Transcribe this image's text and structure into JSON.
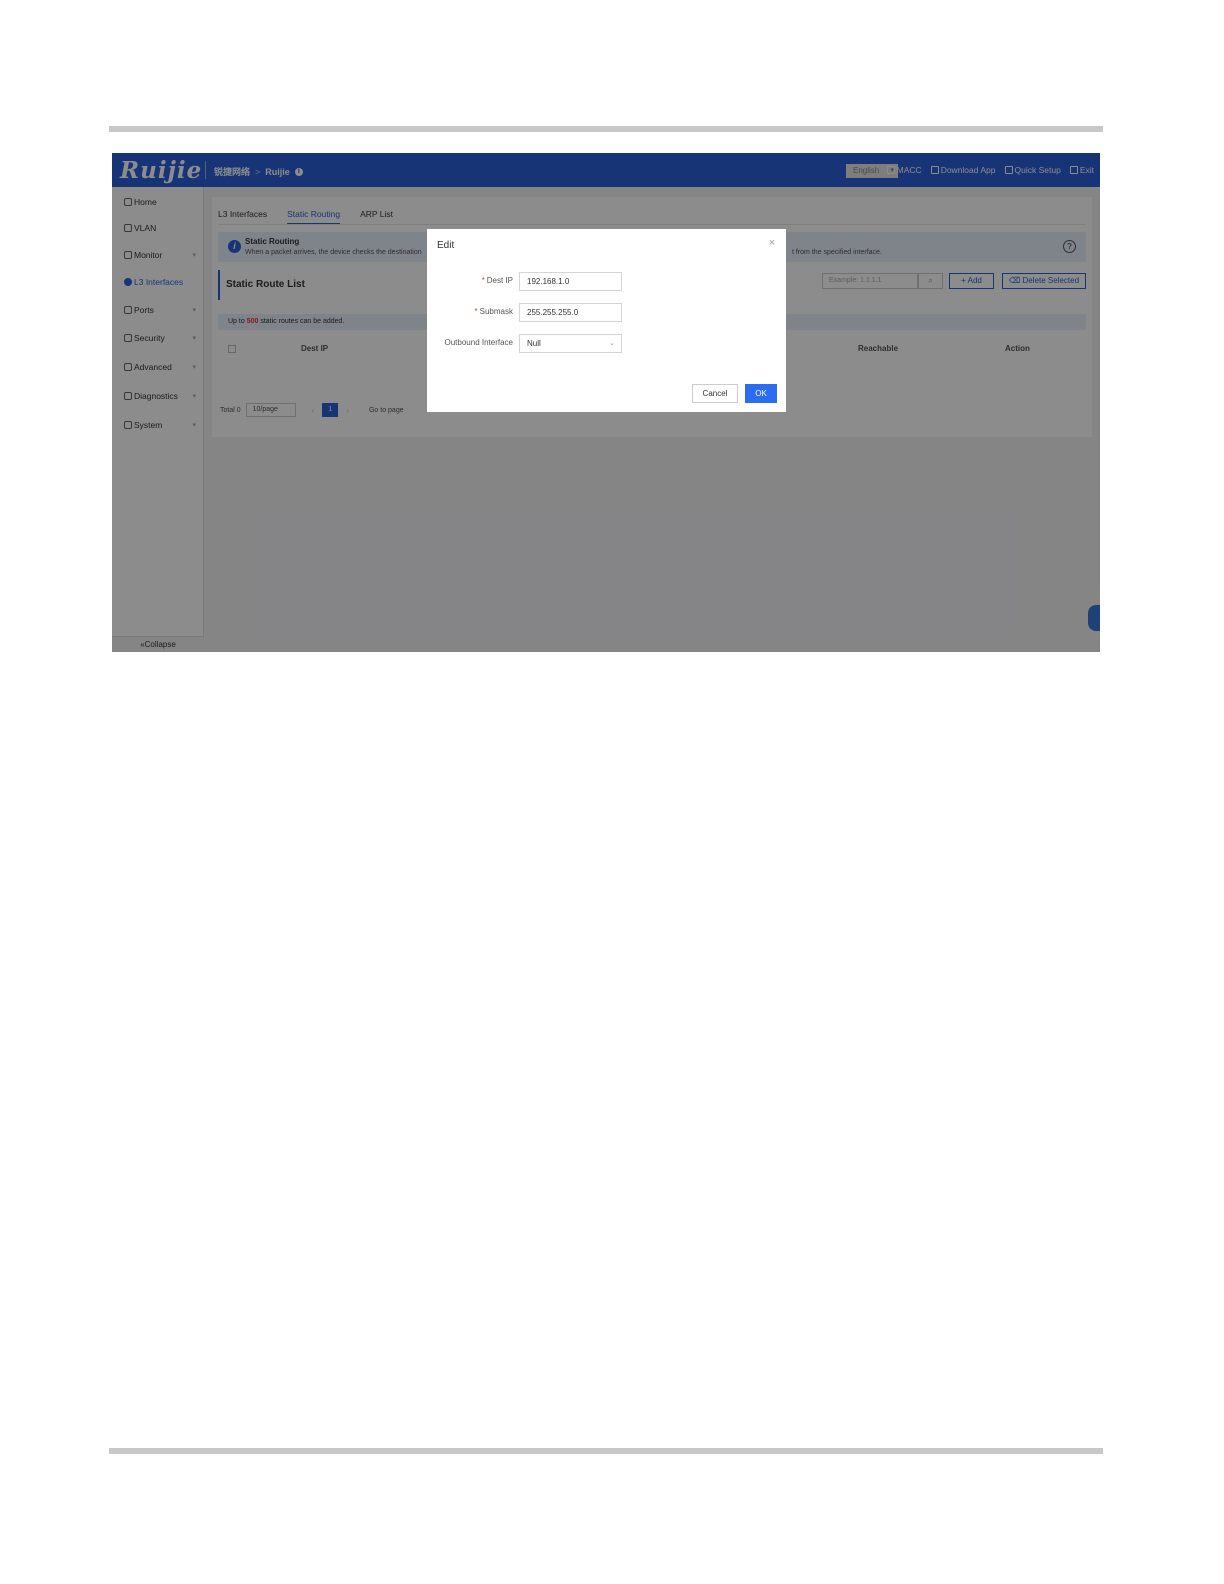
{
  "topbar": {
    "logo": "Ruijie",
    "breadcrumb_site": "锐捷网络",
    "breadcrumb_sep": ">",
    "breadcrumb_device": "Ruijie",
    "language": "English",
    "links": {
      "macc": "MACC",
      "download": "Download App",
      "quick_setup": "Quick Setup",
      "exit": "Exit"
    }
  },
  "sidebar": {
    "items": [
      {
        "label": "Home",
        "icon": "home-icon"
      },
      {
        "label": "VLAN",
        "icon": "vlan-icon"
      },
      {
        "label": "Monitor",
        "icon": "monitor-icon"
      },
      {
        "label": "L3 Interfaces",
        "icon": "l3-icon",
        "active": true
      },
      {
        "label": "Ports",
        "icon": "ports-icon"
      },
      {
        "label": "Security",
        "icon": "security-icon"
      },
      {
        "label": "Advanced",
        "icon": "advanced-icon"
      },
      {
        "label": "Diagnostics",
        "icon": "diagnostics-icon"
      },
      {
        "label": "System",
        "icon": "system-icon"
      }
    ],
    "collapse": "Collapse"
  },
  "tabs": [
    "L3 Interfaces",
    "Static Routing",
    "ARP List"
  ],
  "banner": {
    "title": "Static Routing",
    "text": "When a packet arrives, the device checks the destination",
    "text_end": "t from the specified interface."
  },
  "list": {
    "title": "Static Route List",
    "search_placeholder": "Example: 1.1.1.1",
    "add": "Add",
    "delete_selected": "Delete Selected",
    "limit_prefix": "Up to",
    "limit_num": "500",
    "limit_suffix": "static routes can be added.",
    "columns": [
      "Dest IP",
      "Reachable",
      "Action"
    ]
  },
  "pager": {
    "total": "Total 0",
    "page_size": "10/page",
    "page": "1",
    "goto": "Go to page"
  },
  "modal": {
    "title": "Edit",
    "dest_ip_label": "Dest IP",
    "dest_ip_value": "192.168.1.0",
    "submask_label": "Submask",
    "submask_value": "255.255.255.0",
    "outbound_label": "Outbound Interface",
    "outbound_value": "Null",
    "cancel": "Cancel",
    "ok": "OK"
  },
  "colors": {
    "brand": "#2b5fd9",
    "ok_button": "#2b6cf0",
    "required": "#e33333"
  }
}
